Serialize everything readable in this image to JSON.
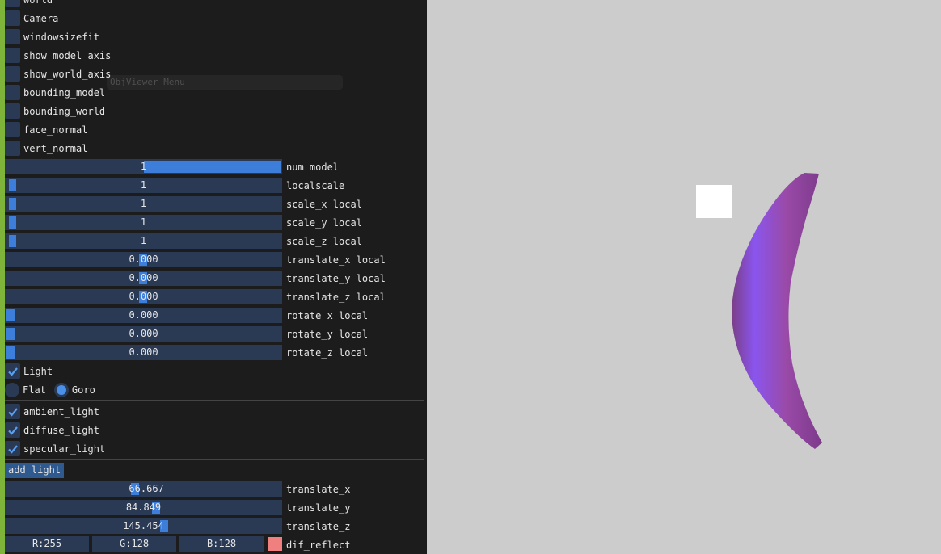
{
  "panel": {
    "ghost_title": "ObjViewer Menu",
    "checkboxes_top": [
      {
        "label": "world"
      },
      {
        "label": "Camera"
      },
      {
        "label": "windowsizefit"
      },
      {
        "label": "show_model_axis"
      },
      {
        "label": "show_world_axis"
      },
      {
        "label": "bounding_model"
      },
      {
        "label": "bounding_world"
      },
      {
        "label": "face_normal"
      },
      {
        "label": "vert_normal"
      }
    ],
    "num_model": {
      "label": "num model",
      "value": "1",
      "fraction": 0.5
    },
    "model_sliders": [
      {
        "label": "localscale",
        "value": "1"
      },
      {
        "label": "scale_x local",
        "value": "1"
      },
      {
        "label": "scale_y local",
        "value": "1"
      },
      {
        "label": "scale_z local",
        "value": "1"
      },
      {
        "label": "translate_x local",
        "value": "0.000"
      },
      {
        "label": "translate_y local",
        "value": "0.000"
      },
      {
        "label": "translate_z local",
        "value": "0.000"
      },
      {
        "label": "rotate_x local",
        "value": "0.000"
      },
      {
        "label": "rotate_y local",
        "value": "0.000"
      },
      {
        "label": "rotate_z local",
        "value": "0.000"
      }
    ],
    "light": {
      "label": "Light",
      "checked": true
    },
    "shading": {
      "flat": "Flat",
      "goro": "Goro",
      "selected": "Goro"
    },
    "light_types": [
      {
        "label": "ambient_light",
        "checked": true
      },
      {
        "label": "diffuse_light",
        "checked": true
      },
      {
        "label": "specular_light",
        "checked": true
      }
    ],
    "add_light_button": "add light",
    "light_sliders": [
      {
        "label": "translate_x",
        "value": "-66.667"
      },
      {
        "label": "translate_y",
        "value": "84.849"
      },
      {
        "label": "translate_z",
        "value": "145.454"
      }
    ],
    "color": {
      "r": "R:255",
      "g": "G:128",
      "b": "B:128",
      "label": "dif_reflect",
      "swatch": "#f08080"
    }
  },
  "viewport": {
    "background": "#cccccc",
    "model_color": "#9a4aa8",
    "highlight_color": "#8a55ee"
  }
}
